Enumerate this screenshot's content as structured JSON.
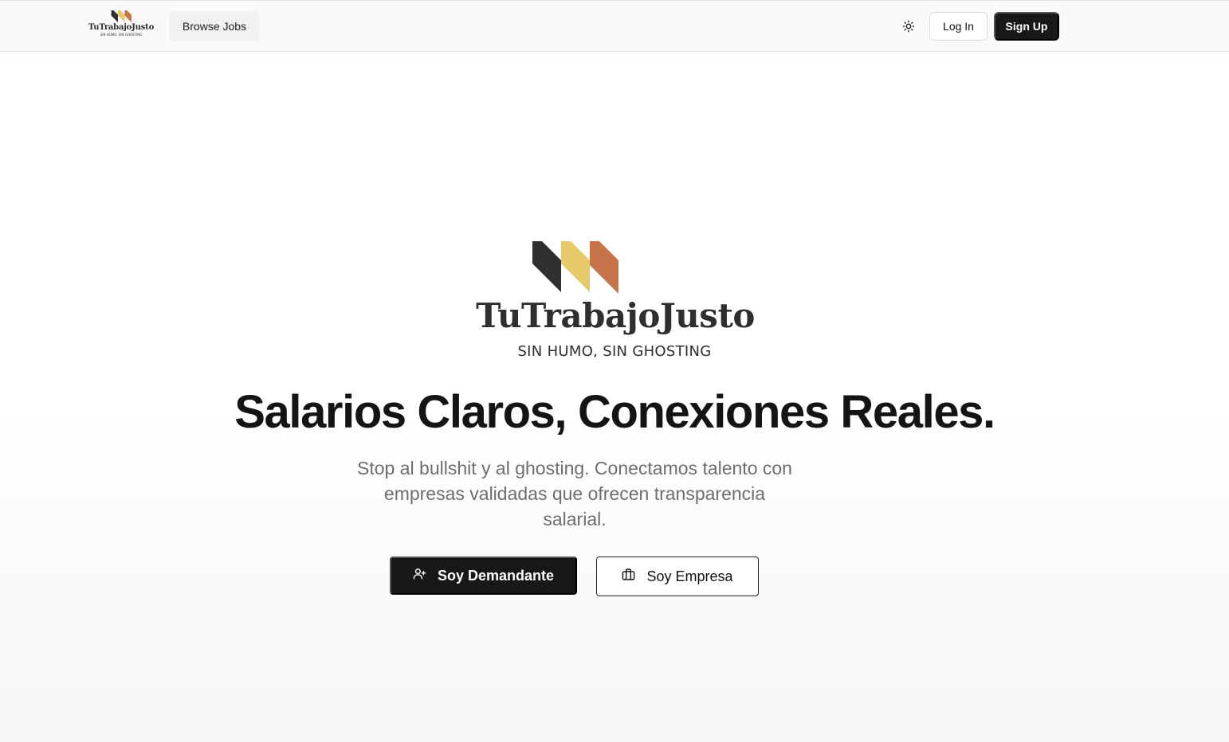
{
  "header": {
    "brand": {
      "name": "TuTrabajoJusto",
      "tagline": "SIN HUMO, SIN GHOSTING",
      "logo_colors": [
        "#2f2f2f",
        "#e8c96a",
        "#c8744a"
      ]
    },
    "nav": {
      "browse_jobs": "Browse Jobs"
    },
    "theme_toggle_icon": "sun-icon",
    "login_label": "Log In",
    "signup_label": "Sign Up"
  },
  "hero": {
    "brand_name": "TuTrabajoJusto",
    "brand_tagline": "SIN HUMO, SIN GHOSTING",
    "headline": "Salarios Claros, Conexiones Reales.",
    "subtitle": "Stop al bullshit y al ghosting. Conectamos talento con empresas validadas que ofrecen transparencia salarial.",
    "cta_candidate": {
      "label": "Soy Demandante",
      "icon": "user-plus-icon"
    },
    "cta_company": {
      "label": "Soy Empresa",
      "icon": "briefcase-icon"
    }
  },
  "colors": {
    "primary_dark": "#18181b",
    "logo_dark": "#2f2f2f",
    "logo_yellow": "#e8c96a",
    "logo_orange": "#c8744a",
    "muted_text": "#6e6e6e"
  }
}
